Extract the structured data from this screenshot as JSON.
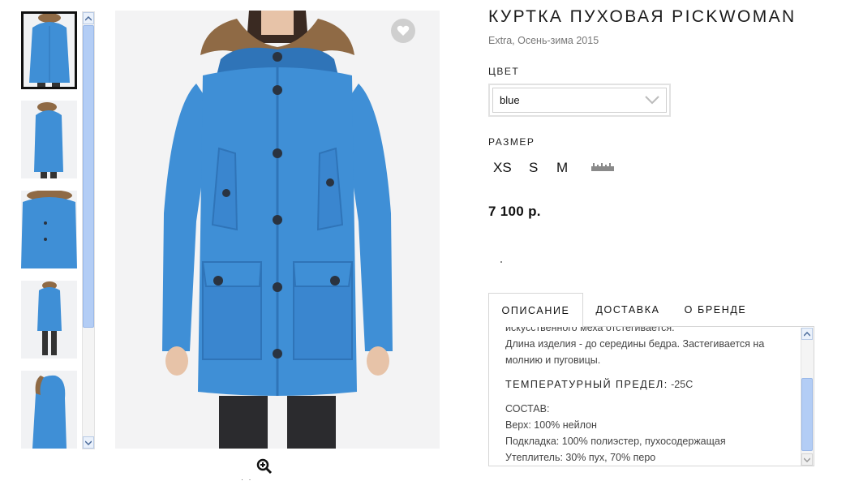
{
  "product": {
    "title": "КУРТКА ПУХОВАЯ PICKWOMAN",
    "subtitle": "Extra, Осень-зима 2015",
    "price": "7 100 р."
  },
  "color": {
    "label": "ЦВЕТ",
    "selected": "blue"
  },
  "size": {
    "label": "РАЗМЕР",
    "options": [
      "XS",
      "S",
      "M"
    ]
  },
  "tabs": [
    {
      "label": "ОПИСАНИЕ",
      "active": true
    },
    {
      "label": "ДОСТАВКА",
      "active": false
    },
    {
      "label": "О БРЕНДЕ",
      "active": false
    }
  ],
  "description": {
    "line_partial": "искусственного меха отстегивается.",
    "line_length": "Длина изделия - до середины бедра. Застегивается на",
    "line_closure": "молнию и пуговицы.",
    "temp_label": "ТЕМПЕРАТУРНЫЙ ПРЕДЕЛ:",
    "temp_value": " -25С",
    "composition_label": "СОСТАВ:",
    "outer": "Верх: 100% нейлон",
    "lining": "Подкладка: 100% полиэстер, пухосодержащая",
    "fill": "Утеплитель: 30% пух, 70% перо"
  },
  "zoom_dots": "· ·",
  "icons": {
    "favorite": "heart-icon",
    "zoom": "zoom-in-icon",
    "size_chart": "ruler-icon",
    "dropdown": "chevron-down-icon"
  },
  "colors": {
    "jacket": "#3f8fd6",
    "jacket_shadow": "#2f74b8",
    "fur": "#8f6a45",
    "accent_scroll": "#b3cdf5"
  }
}
